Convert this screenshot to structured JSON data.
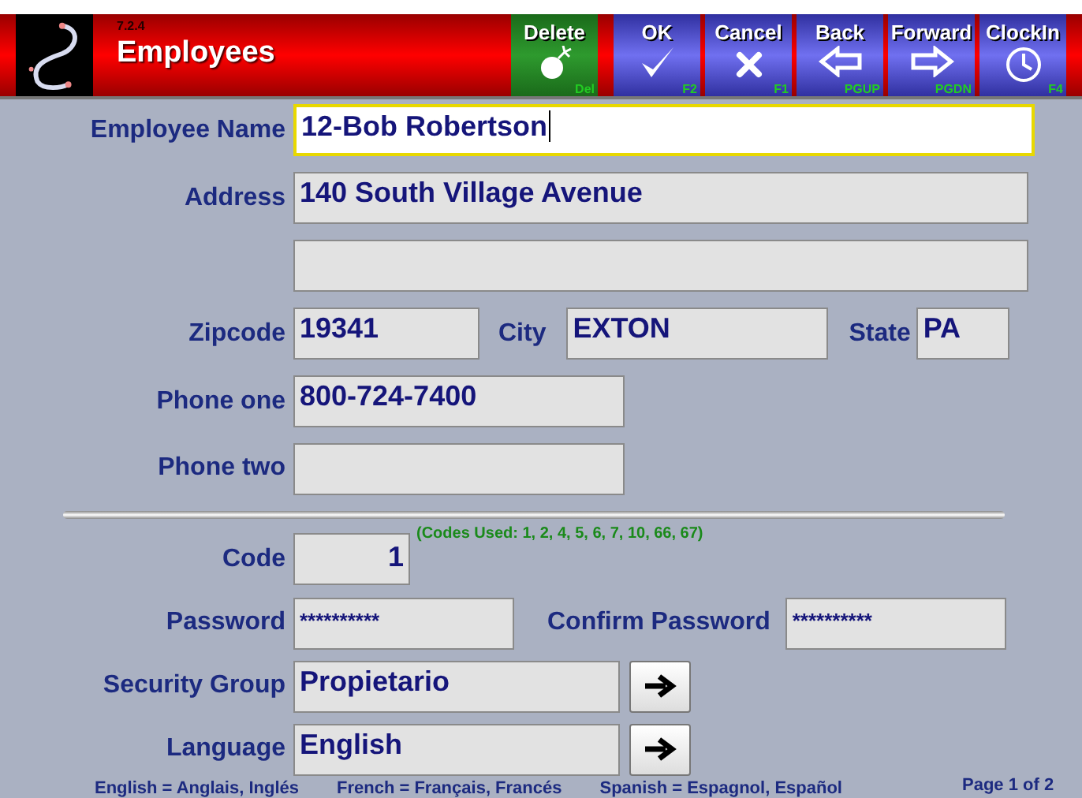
{
  "header": {
    "version": "7.2.4",
    "title": "Employees"
  },
  "toolbar": [
    {
      "kind": "delete",
      "label": "Delete",
      "hotkey": "Del"
    },
    {
      "kind": "ok",
      "label": "OK",
      "hotkey": "F2"
    },
    {
      "kind": "cancel",
      "label": "Cancel",
      "hotkey": "F1"
    },
    {
      "kind": "back",
      "label": "Back",
      "hotkey": "PGUP"
    },
    {
      "kind": "forward",
      "label": "Forward",
      "hotkey": "PGDN"
    },
    {
      "kind": "clockin",
      "label": "ClockIn",
      "hotkey": "F4"
    }
  ],
  "employee_name": {
    "label": "Employee Name",
    "value": "12-Bob Robertson",
    "focused": true
  },
  "address": {
    "label": "Address",
    "value": "140 South Village Avenue"
  },
  "zipcode": {
    "label": "Zipcode",
    "value": "19341"
  },
  "city": {
    "label": "City",
    "value": "EXTON"
  },
  "state": {
    "label": "State",
    "value": "PA"
  },
  "phone_one": {
    "label": "Phone one",
    "value": "800-724-7400"
  },
  "phone_two": {
    "label": "Phone two"
  },
  "code": {
    "label": "Code",
    "value": "1",
    "codes_used": "(Codes Used: 1, 2, 4, 5, 6, 7, 10, 66, 67)"
  },
  "password": {
    "label": "Password",
    "value": "**********"
  },
  "confirm_password": {
    "label": "Confirm Password",
    "value": "**********"
  },
  "security_group": {
    "label": "Security Group",
    "value": "Propietario"
  },
  "language": {
    "label": "Language",
    "value": "English"
  },
  "language_notes": [
    "English = Anglais, Inglés",
    "French = Français, Francés",
    "Spanish = Espagnol, Español"
  ],
  "page_indicator": "Page 1 of 2"
}
